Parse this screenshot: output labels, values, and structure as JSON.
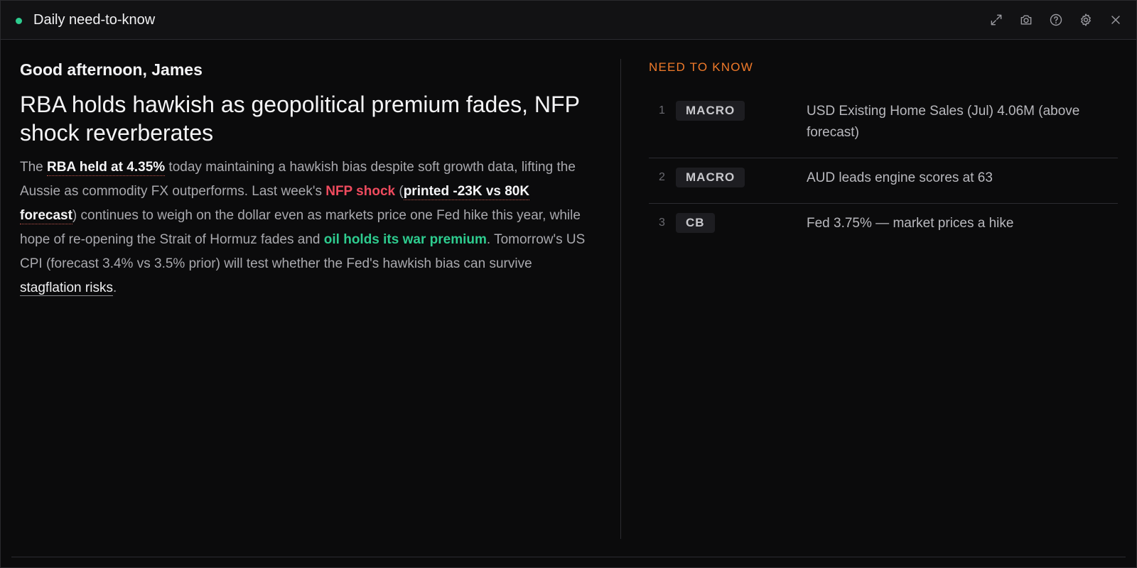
{
  "window": {
    "title": "Daily need-to-know",
    "status_color": "#2ecc8f",
    "icons": [
      "expand-icon",
      "camera-icon",
      "help-icon",
      "settings-icon",
      "close-icon"
    ]
  },
  "briefing": {
    "greeting": "Good afternoon, James",
    "headline": "RBA holds hawkish as geopolitical premium fades, NFP shock reverberates",
    "summary": {
      "t1": "The ",
      "h1": "RBA held at 4.35%",
      "t2": " today maintaining a hawkish bias despite soft growth data, lifting the Aussie as commodity FX outperforms. Last week's ",
      "h2": "NFP shock",
      "t3": " (",
      "h3": "printed -23K vs 80K forecast",
      "t4": ") continues to weigh on the dollar even as markets price one Fed hike this year, while hope of re-opening the Strait of Hormuz fades and ",
      "h4": "oil holds its war premium",
      "t5": ". Tomorrow's US CPI (forecast 3.4% vs 3.5% prior) will test whether the Fed's hawkish bias can survive ",
      "h5": "stagflation risks",
      "t6": "."
    }
  },
  "need_to_know": {
    "title": "NEED TO KNOW",
    "items": [
      {
        "num": "1",
        "tag": "MACRO",
        "text": "USD Existing Home Sales (Jul) 4.06M (above forecast)"
      },
      {
        "num": "2",
        "tag": "MACRO",
        "text": "AUD leads engine scores at 63"
      },
      {
        "num": "3",
        "tag": "CB",
        "text": "Fed 3.75% — market prices a hike"
      }
    ]
  },
  "colors": {
    "accent_orange": "#f07a2a",
    "negative_red": "#ef4b5e",
    "positive_green": "#2ecc8f"
  }
}
